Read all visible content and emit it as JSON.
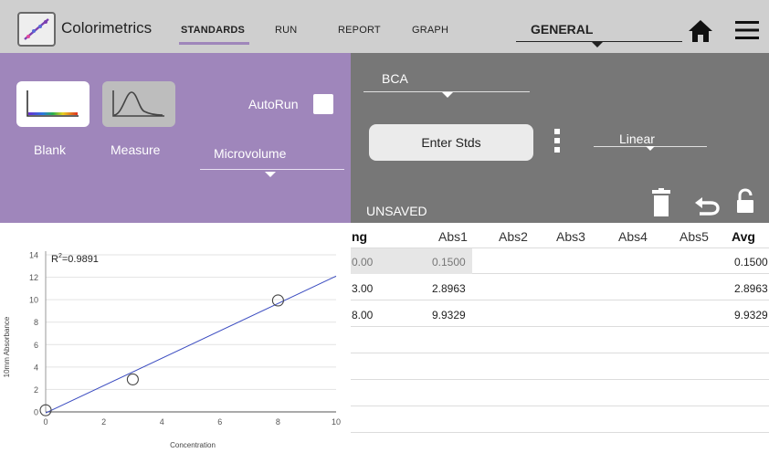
{
  "header": {
    "app_name": "Colorimetrics",
    "tabs": [
      {
        "label": "STANDARDS",
        "active": true
      },
      {
        "label": "RUN",
        "active": false
      },
      {
        "label": "REPORT",
        "active": false
      },
      {
        "label": "GRAPH",
        "active": false
      }
    ],
    "mode": "GENERAL",
    "icons": [
      "home-icon",
      "menu-icon"
    ]
  },
  "controls": {
    "blank_label": "Blank",
    "measure_label": "Measure",
    "autorun_label": "AutoRun",
    "autorun_checked": false,
    "sample_type": "Microvolume"
  },
  "assay": {
    "name": "BCA",
    "enter_stds_label": "Enter Stds",
    "curve_fit": "Linear",
    "status": "UNSAVED"
  },
  "table": {
    "columns": [
      "ng",
      "Abs1",
      "Abs2",
      "Abs3",
      "Abs4",
      "Abs5",
      "Avg"
    ],
    "rows": [
      {
        "ng": "0.00",
        "abs1": "0.1500",
        "avg": "0.1500"
      },
      {
        "ng": "3.00",
        "abs1": "2.8963",
        "avg": "2.8963"
      },
      {
        "ng": "8.00",
        "abs1": "9.9329",
        "avg": "9.9329"
      }
    ]
  },
  "colors": {
    "purple_panel": "#9f86bb",
    "gray_panel": "#777777",
    "topbar": "#cfcfcf",
    "fit_line": "#3a4bc0"
  },
  "chart_data": {
    "type": "scatter",
    "r2_prefix": "R",
    "r2_sup": "2",
    "r2_value": "=0.9891",
    "xlabel": "Concentration",
    "ylabel": "10mm Absorbance",
    "xlim": [
      0,
      10
    ],
    "ylim": [
      0,
      14
    ],
    "xticks": [
      0,
      2,
      4,
      6,
      8,
      10
    ],
    "yticks": [
      0,
      2,
      4,
      6,
      8,
      10,
      12,
      14
    ],
    "points": [
      {
        "x": 0,
        "y": 0.15
      },
      {
        "x": 3,
        "y": 2.8963
      },
      {
        "x": 8,
        "y": 9.9329
      }
    ],
    "fit_line": {
      "x": [
        0,
        10
      ],
      "y": [
        -0.1,
        12.1
      ]
    },
    "grid": true
  }
}
